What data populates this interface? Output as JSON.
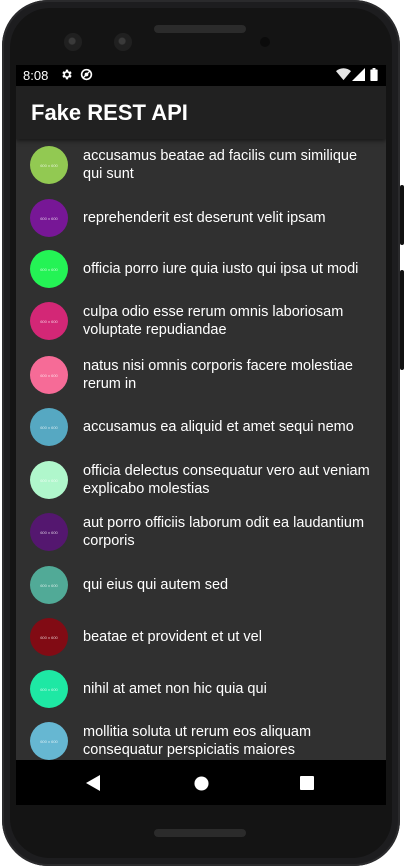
{
  "status": {
    "time": "8:08",
    "icons": [
      "settings-icon",
      "sync-icon",
      "wifi-icon",
      "signal-icon",
      "battery-icon"
    ]
  },
  "appbar": {
    "title": "Fake REST API"
  },
  "list": {
    "items": [
      {
        "title": "accusamus beatae ad facilis cum similique qui sunt",
        "thumb_label": "600 x 600",
        "color": "#92c952"
      },
      {
        "title": "reprehenderit est deserunt velit ipsam",
        "thumb_label": "600 x 600",
        "color": "#771796"
      },
      {
        "title": "officia porro iure quia iusto qui ipsa ut modi",
        "thumb_label": "600 x 600",
        "color": "#24f355"
      },
      {
        "title": "culpa odio esse rerum omnis laboriosam voluptate repudiandae",
        "thumb_label": "600 x 600",
        "color": "#d32776"
      },
      {
        "title": "natus nisi omnis corporis facere molestiae rerum in",
        "thumb_label": "600 x 600",
        "color": "#f66b97"
      },
      {
        "title": "accusamus ea aliquid et amet sequi nemo",
        "thumb_label": "600 x 600",
        "color": "#56a8c2"
      },
      {
        "title": "officia delectus consequatur vero aut veniam explicabo molestias",
        "thumb_label": "600 x 600",
        "color": "#b0f7cc"
      },
      {
        "title": "aut porro officiis laborum odit ea laudantium corporis",
        "thumb_label": "600 x 600",
        "color": "#54176f"
      },
      {
        "title": "qui eius qui autem sed",
        "thumb_label": "600 x 600",
        "color": "#51aa97"
      },
      {
        "title": "beatae et provident et ut vel",
        "thumb_label": "600 x 600",
        "color": "#810b14"
      },
      {
        "title": "nihil at amet non hic quia qui",
        "thumb_label": "600 x 600",
        "color": "#1ee8a4"
      },
      {
        "title": "mollitia soluta ut rerum eos aliquam consequatur perspiciatis maiores",
        "thumb_label": "600 x 600",
        "color": "#66b7d2"
      }
    ]
  },
  "navbar": {
    "buttons": [
      "back-icon",
      "home-icon",
      "recents-icon"
    ]
  }
}
